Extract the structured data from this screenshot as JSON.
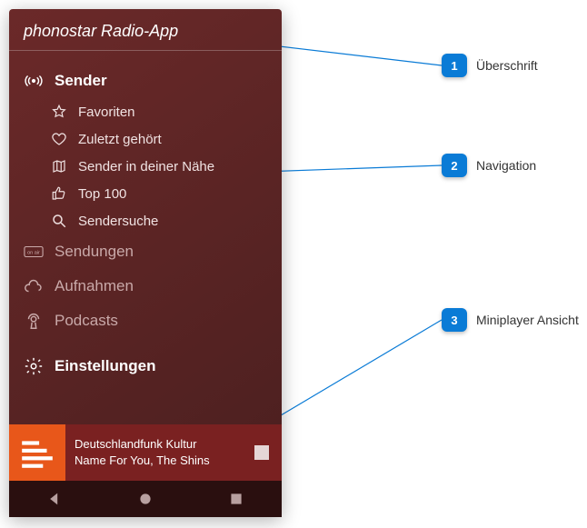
{
  "app": {
    "title": "phonostar Radio-App"
  },
  "nav": {
    "sender": {
      "label": "Sender",
      "items": {
        "favoriten": "Favoriten",
        "zuletzt": "Zuletzt gehört",
        "naehe": "Sender in deiner Nähe",
        "top100": "Top 100",
        "suche": "Sendersuche"
      }
    },
    "sendungen": "Sendungen",
    "aufnahmen": "Aufnahmen",
    "podcasts": "Podcasts",
    "einstellungen": "Einstellungen"
  },
  "miniplayer": {
    "station": "Deutschlandfunk Kultur",
    "track": "Name For You, The Shins"
  },
  "callouts": {
    "c1": {
      "num": "1",
      "label": "Überschrift"
    },
    "c2": {
      "num": "2",
      "label": "Navigation"
    },
    "c3": {
      "num": "3",
      "label": "Miniplayer Ansicht"
    }
  }
}
